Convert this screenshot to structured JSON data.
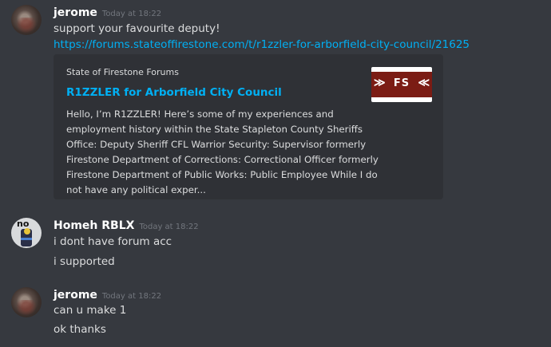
{
  "messages": [
    {
      "author": "jerome",
      "timestamp": "Today at 18:22",
      "lines": [
        "support your favourite deputy!"
      ],
      "link": "https://forums.stateoffirestone.com/t/r1zzler-for-arborfield-city-council/21625",
      "embed": {
        "provider": "State of Firestone Forums",
        "title": "R1ZZLER for Arborfield City Council",
        "description_lines": [
          "Hello, I’m R1ZZLER! Here’s some of my experiences and",
          "employment history within the State Stapleton County Sheriffs",
          "Office: Deputy Sheriff CFL Warrior Security: Supervisor formerly",
          "Firestone Department of Corrections: Correctional Officer formerly",
          "Firestone Department of Public Works: Public Employee While I do",
          "not have any political exper..."
        ],
        "thumbnail_text": "FS"
      }
    },
    {
      "author": "Homeh RBLX",
      "timestamp": "Today at 18:22",
      "avatar_text": "no",
      "lines": [
        "i dont have forum acc",
        "i supported"
      ]
    },
    {
      "author": "jerome",
      "timestamp": "Today at 18:22",
      "lines": [
        "can u make 1",
        "ok thanks"
      ]
    }
  ]
}
